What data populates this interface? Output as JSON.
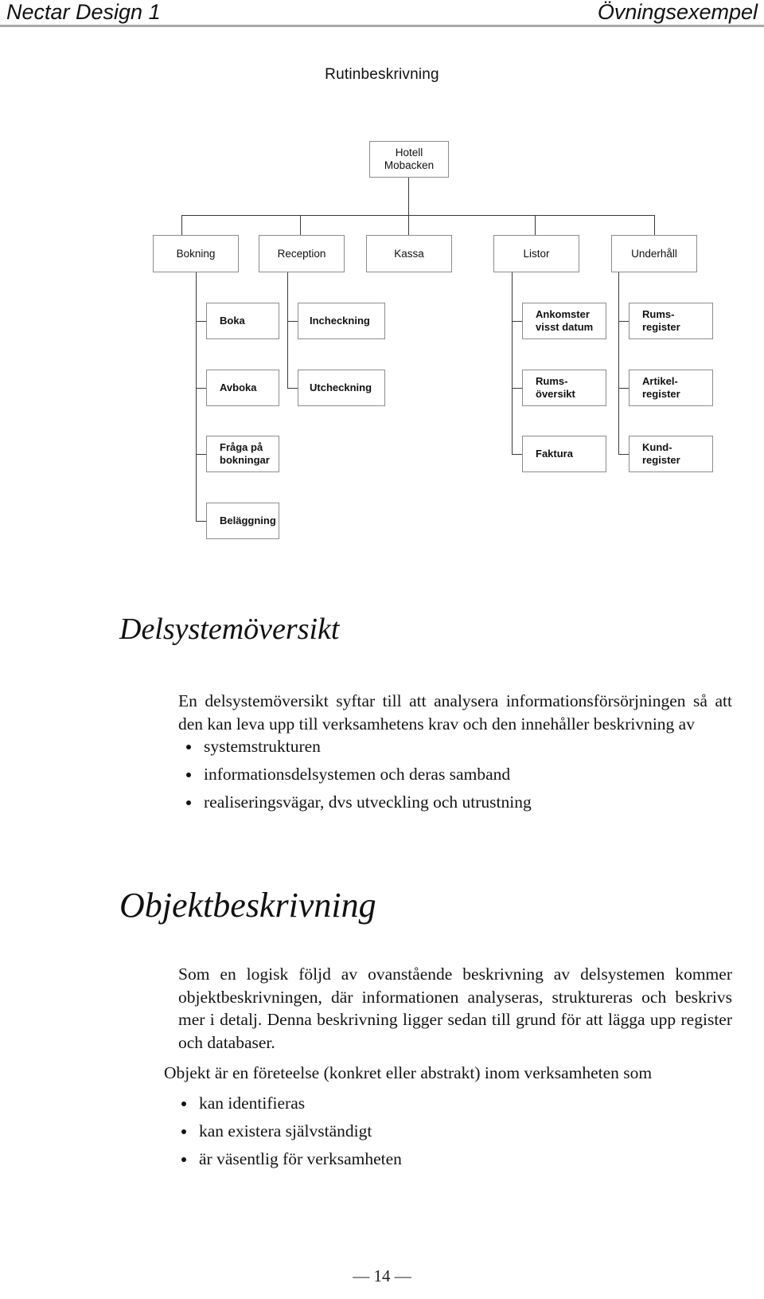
{
  "header": {
    "left": "Nectar Design 1",
    "right": "Övningsexempel"
  },
  "doc_title": "Rutinbeskrivning",
  "org_chart": {
    "root": "Hotell\nMobacken",
    "level2": [
      {
        "label": "Bokning"
      },
      {
        "label": "Reception"
      },
      {
        "label": "Kassa"
      },
      {
        "label": "Listor"
      },
      {
        "label": "Underhåll"
      }
    ],
    "level3": {
      "bokning": [
        "Boka",
        "Avboka",
        "Fråga på\nbokningar",
        "Beläggning"
      ],
      "reception": [
        "Incheckning",
        "Utcheckning"
      ],
      "kassa": [],
      "listor": [
        "Ankomster\nvisst datum",
        "Rums-\növersikt",
        "Faktura"
      ],
      "underhall": [
        "Rums-\nregister",
        "Artikel-\nregister",
        "Kund-\nregister"
      ]
    }
  },
  "sections": [
    {
      "heading": "Delsystemöversikt",
      "paragraph": "En delsystemöversikt syftar till att analysera informationsförsörjningen så att den kan leva upp till verksamhetens krav och den innehåller beskrivning av",
      "bullets": [
        "systemstrukturen",
        "informationsdelsystemen och deras samband",
        "realiseringsvägar, dvs utveckling och utrustning"
      ]
    },
    {
      "heading": "Objektbeskrivning",
      "paragraph": "Som en logisk följd av ovanstående beskrivning av delsystemen kommer objektbeskrivningen, där informationen analyseras, struktureras och beskrivs mer i detalj. Denna beskrivning ligger sedan till grund för att lägga upp register och databaser.",
      "paragraph2": "Objekt är en företeelse (konkret eller abstrakt) inom verksamheten som",
      "bullets": [
        "kan identifieras",
        "kan existera självständigt",
        "är väsentlig för verksamheten"
      ]
    }
  ],
  "footer": "— 14 —"
}
